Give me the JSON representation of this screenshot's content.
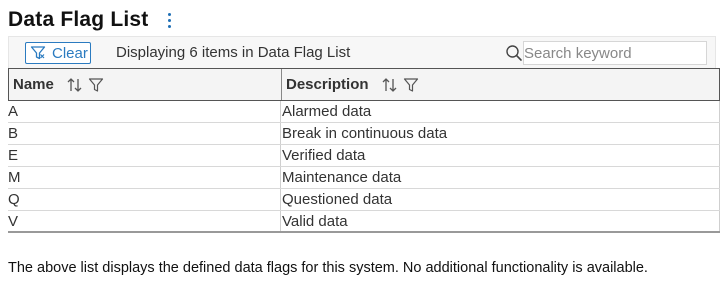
{
  "header": {
    "title": "Data Flag List",
    "menu_icon": "kebab-menu-icon"
  },
  "toolbar": {
    "clear_label": "Clear",
    "status_text": "Displaying 6 items in Data Flag List",
    "search_placeholder": "Search keyword",
    "search_value": ""
  },
  "table": {
    "columns": [
      "Name",
      "Description"
    ],
    "rows": [
      {
        "name": "A",
        "description": "Alarmed data"
      },
      {
        "name": "B",
        "description": "Break in continuous data"
      },
      {
        "name": "E",
        "description": "Verified data"
      },
      {
        "name": "M",
        "description": "Maintenance data"
      },
      {
        "name": "Q",
        "description": "Questioned data"
      },
      {
        "name": "V",
        "description": "Valid data"
      }
    ]
  },
  "footer": {
    "text": "The above list displays the defined data flags for this system. No additional functionality is available."
  },
  "colors": {
    "accent": "#2b7bc0",
    "menu_dots": "#1f6fb5"
  }
}
